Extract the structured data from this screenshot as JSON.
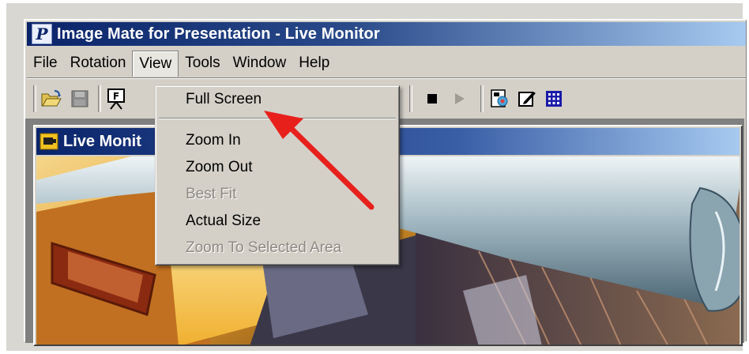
{
  "window": {
    "title": "Image Mate for Presentation - Live Monitor",
    "app_icon_letter": "P"
  },
  "menubar": {
    "items": [
      {
        "label": "File"
      },
      {
        "label": "Rotation"
      },
      {
        "label": "View",
        "active": true
      },
      {
        "label": "Tools"
      },
      {
        "label": "Window"
      },
      {
        "label": "Help"
      }
    ]
  },
  "toolbar": {
    "buttons": [
      "open-folder-icon",
      "save-disk-icon",
      "presentation-icon",
      "stop-icon",
      "play-icon",
      "capture-icon",
      "edit-icon",
      "grid-icon"
    ],
    "presentation_letter": "F"
  },
  "view_menu": {
    "items": [
      {
        "label": "Full Screen",
        "enabled": true
      },
      {
        "label": "Zoom In",
        "enabled": true
      },
      {
        "label": "Zoom Out",
        "enabled": true
      },
      {
        "label": "Best Fit",
        "enabled": false
      },
      {
        "label": "Actual Size",
        "enabled": true
      },
      {
        "label": "Zoom To Selected Area",
        "enabled": false
      }
    ]
  },
  "child_window": {
    "title": "Live Monit"
  },
  "colors": {
    "titlebar": "#0a246a",
    "menu_bg": "#d4d0c8",
    "arrow": "#e8201c",
    "grid_icon": "#1a1aa8"
  }
}
